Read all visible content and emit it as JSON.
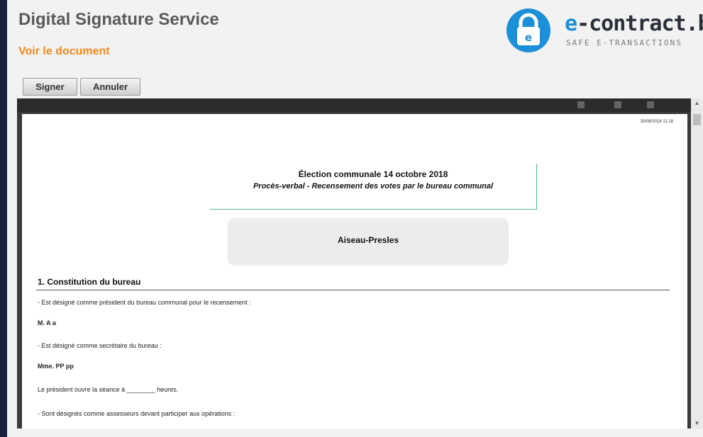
{
  "header": {
    "app_title": "Digital Signature Service",
    "subtitle": "Voir le document"
  },
  "logo": {
    "prefix": "e",
    "name": "-contract.be",
    "tagline": "SAFE E-TRANSACTIONS",
    "brand_color": "#1b8fd8",
    "icon": "lock-icon"
  },
  "toolbar": {
    "sign_label": "Signer",
    "cancel_label": "Annuler"
  },
  "document": {
    "timestamp": "30/08/2018 11:18",
    "title": "Élection communale 14 octobre 2018",
    "subtitle": "Procès-verbal - Recensement des votes par le bureau communal",
    "commune": "Aiseau-Presles",
    "section_title": "1. Constitution du bureau",
    "lines": [
      "- Est désigné comme président du bureau communal pour le recensement :",
      "M. A a",
      "- Est désigné comme secrétaire du bureau :",
      "Mme. PP pp",
      "Le président ouvre la séance à ________ heures.",
      "- Sont désignés comme assesseurs devant participer aux opérations :"
    ]
  },
  "colors": {
    "accent": "#f08a1c",
    "title_text": "#5a5a5a",
    "frame_border": "#1a2140"
  }
}
